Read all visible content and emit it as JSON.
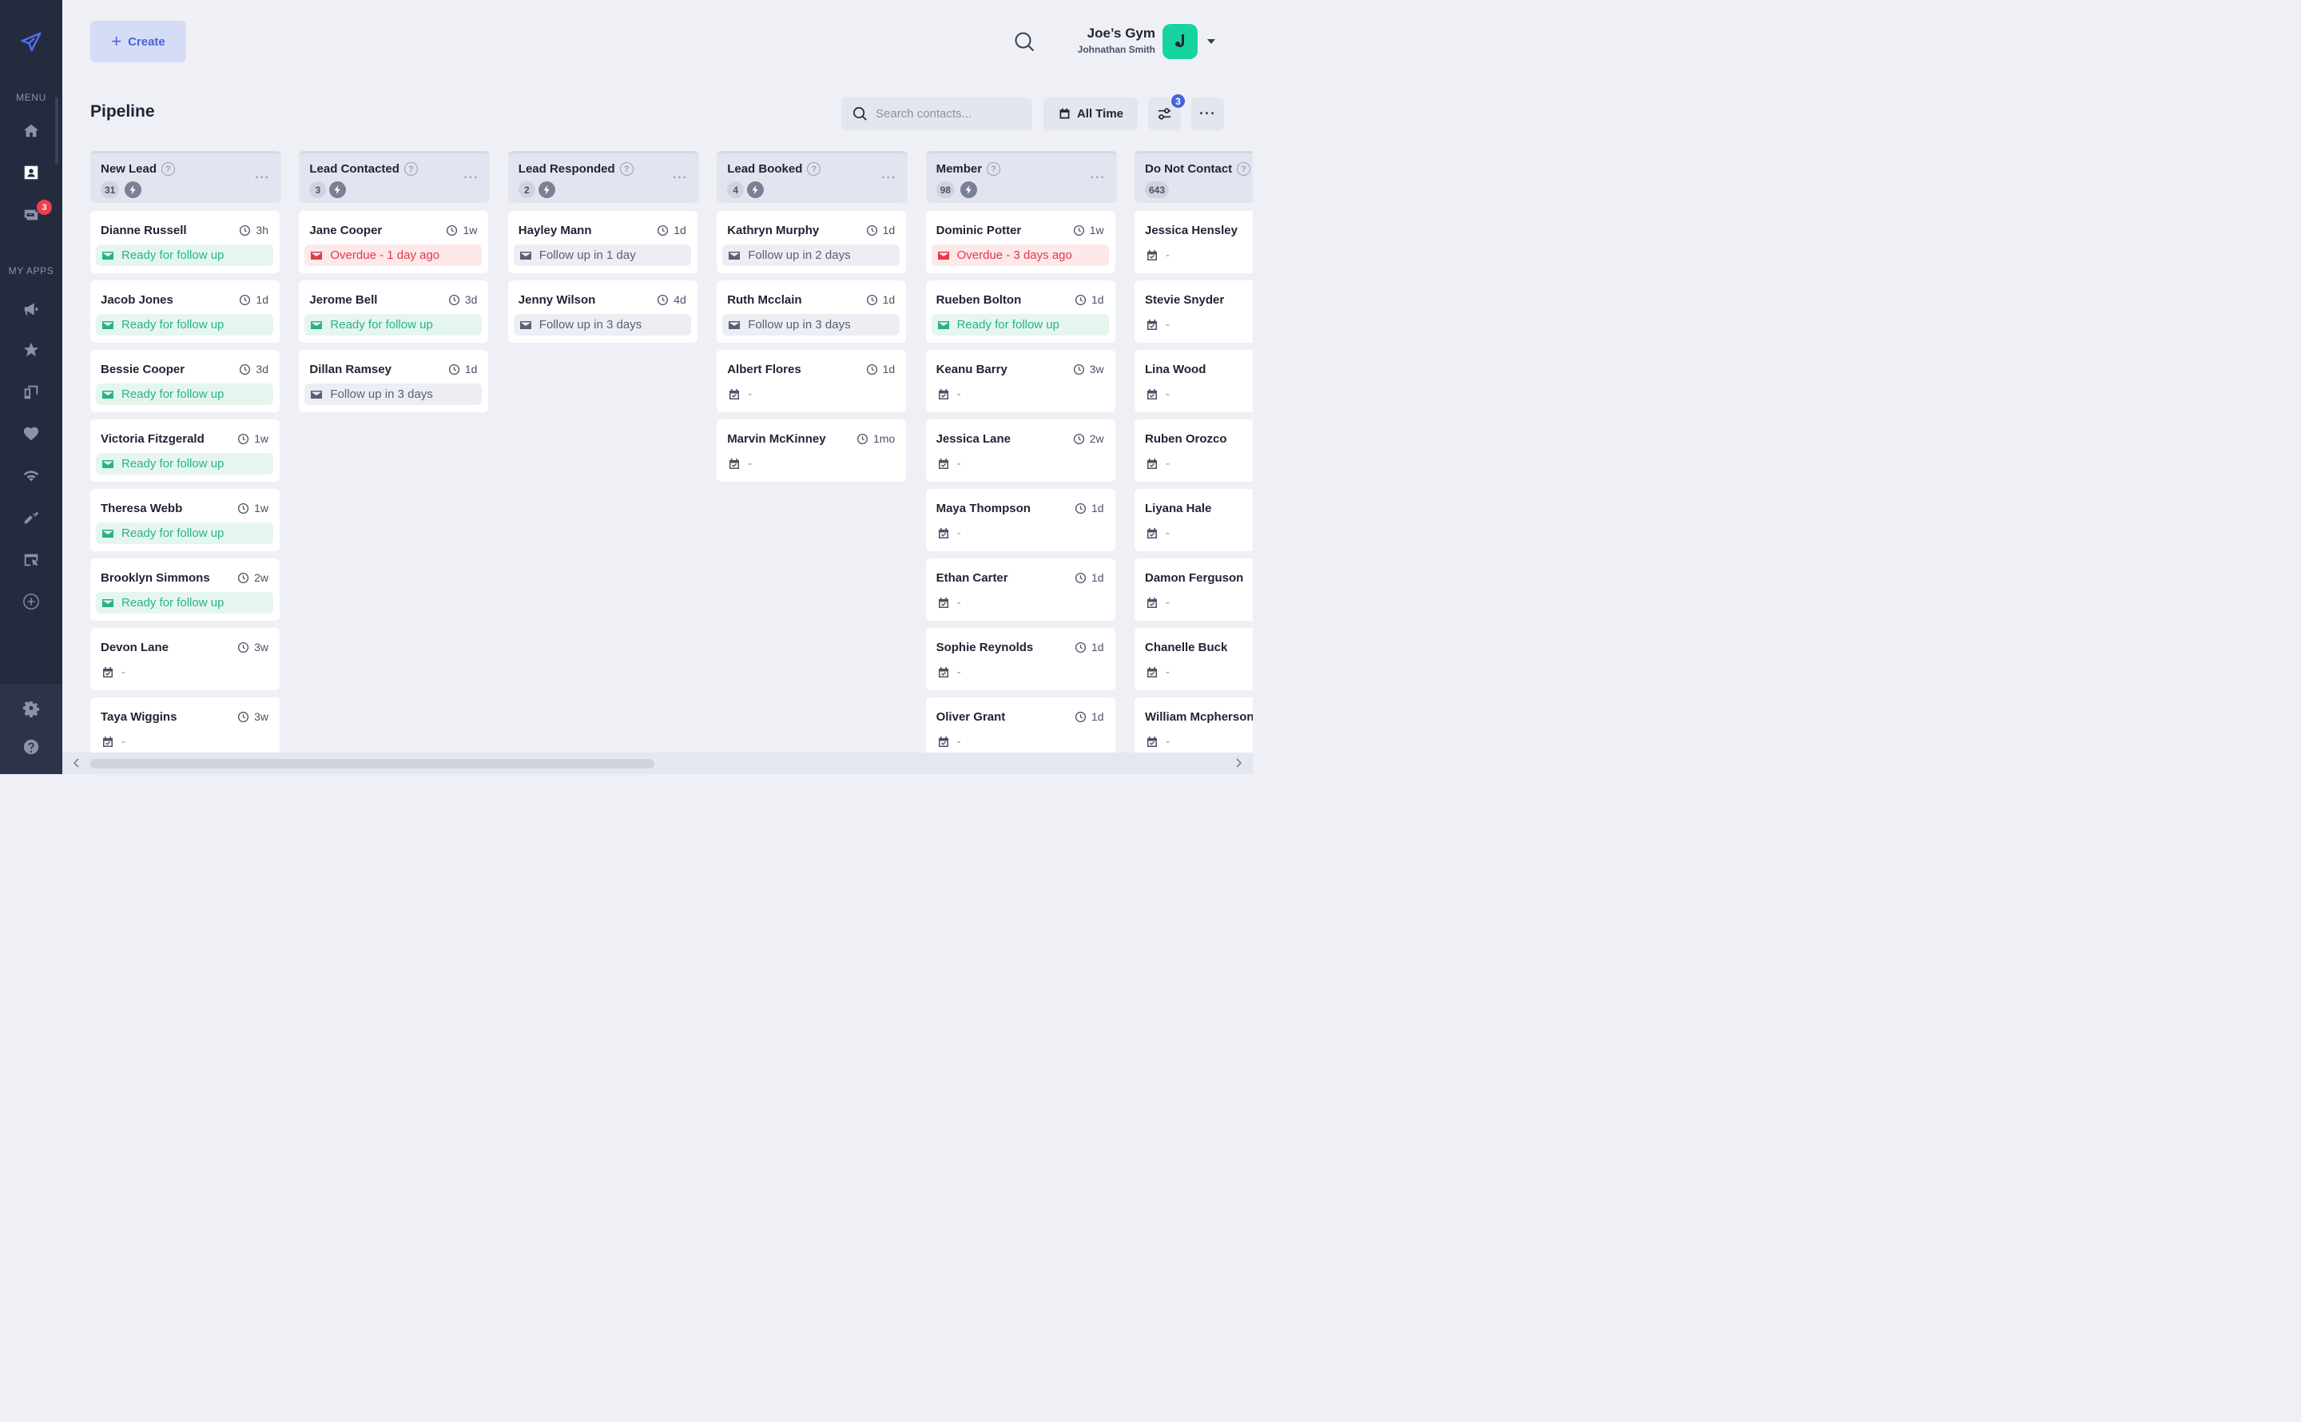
{
  "sidebar": {
    "menu_label": "MENU",
    "apps_label": "MY APPS",
    "inbox_badge": "3"
  },
  "header": {
    "create_label": "Create",
    "account_name": "Joe’s Gym",
    "account_user": "Johnathan Smith"
  },
  "toolbar": {
    "page_title": "Pipeline",
    "search_placeholder": "Search contacts...",
    "time_filter": "All Time",
    "filter_count": "3"
  },
  "colors": {
    "accent": "#4a63d9",
    "ready": "#2bb381",
    "overdue": "#e23a48",
    "avatar": "#17d3a0",
    "sidebar": "#252b3f"
  },
  "columns": [
    {
      "title": "New Lead",
      "count": "31",
      "automation": true,
      "cards": [
        {
          "name": "Dianne Russell",
          "age": "3h",
          "status": "Ready for follow up",
          "kind": "green"
        },
        {
          "name": "Jacob Jones",
          "age": "1d",
          "status": "Ready for follow up",
          "kind": "green"
        },
        {
          "name": "Bessie Cooper",
          "age": "3d",
          "status": "Ready for follow up",
          "kind": "green"
        },
        {
          "name": "Victoria Fitzgerald",
          "age": "1w",
          "status": "Ready for follow up",
          "kind": "green"
        },
        {
          "name": "Theresa Webb",
          "age": "1w",
          "status": "Ready for follow up",
          "kind": "green"
        },
        {
          "name": "Brooklyn Simmons",
          "age": "2w",
          "status": "Ready for follow up",
          "kind": "green"
        },
        {
          "name": "Devon Lane",
          "age": "3w",
          "status": "-",
          "kind": "plain"
        },
        {
          "name": "Taya Wiggins",
          "age": "3w",
          "status": "-",
          "kind": "plain"
        }
      ]
    },
    {
      "title": "Lead Contacted",
      "count": "3",
      "automation": true,
      "cards": [
        {
          "name": "Jane Cooper",
          "age": "1w",
          "status": "Overdue - 1 day ago",
          "kind": "red"
        },
        {
          "name": "Jerome Bell",
          "age": "3d",
          "status": "Ready for follow up",
          "kind": "green"
        },
        {
          "name": "Dillan Ramsey",
          "age": "1d",
          "status": "Follow up in 3 days",
          "kind": "gray"
        }
      ]
    },
    {
      "title": "Lead Responded",
      "count": "2",
      "automation": true,
      "cards": [
        {
          "name": "Hayley Mann",
          "age": "1d",
          "status": "Follow up in 1 day",
          "kind": "gray"
        },
        {
          "name": "Jenny Wilson",
          "age": "4d",
          "status": "Follow up in 3 days",
          "kind": "gray"
        }
      ]
    },
    {
      "title": "Lead Booked",
      "count": "4",
      "automation": true,
      "cards": [
        {
          "name": "Kathryn Murphy",
          "age": "1d",
          "status": "Follow up in 2 days",
          "kind": "gray"
        },
        {
          "name": "Ruth Mcclain",
          "age": "1d",
          "status": "Follow up in 3 days",
          "kind": "gray"
        },
        {
          "name": "Albert Flores",
          "age": "1d",
          "status": "-",
          "kind": "plain"
        },
        {
          "name": "Marvin McKinney",
          "age": "1mo",
          "status": "-",
          "kind": "plain"
        }
      ]
    },
    {
      "title": "Member",
      "count": "98",
      "automation": true,
      "cards": [
        {
          "name": "Dominic Potter",
          "age": "1w",
          "status": "Overdue - 3 days ago",
          "kind": "red"
        },
        {
          "name": "Rueben Bolton",
          "age": "1d",
          "status": "Ready for follow up",
          "kind": "green"
        },
        {
          "name": "Keanu Barry",
          "age": "3w",
          "status": "-",
          "kind": "plain"
        },
        {
          "name": "Jessica Lane",
          "age": "2w",
          "status": "-",
          "kind": "plain"
        },
        {
          "name": "Maya Thompson",
          "age": "1d",
          "status": "-",
          "kind": "plain"
        },
        {
          "name": "Ethan Carter",
          "age": "1d",
          "status": "-",
          "kind": "plain"
        },
        {
          "name": "Sophie Reynolds",
          "age": "1d",
          "status": "-",
          "kind": "plain"
        },
        {
          "name": "Oliver Grant",
          "age": "1d",
          "status": "-",
          "kind": "plain"
        }
      ]
    },
    {
      "title": "Do Not Contact",
      "count": "643",
      "automation": false,
      "cards": [
        {
          "name": "Jessica Hensley",
          "age": "",
          "status": "-",
          "kind": "plain"
        },
        {
          "name": "Stevie Snyder",
          "age": "",
          "status": "-",
          "kind": "plain"
        },
        {
          "name": "Lina Wood",
          "age": "",
          "status": "-",
          "kind": "plain"
        },
        {
          "name": "Ruben Orozco",
          "age": "",
          "status": "-",
          "kind": "plain"
        },
        {
          "name": "Liyana Hale",
          "age": "",
          "status": "-",
          "kind": "plain"
        },
        {
          "name": "Damon Ferguson",
          "age": "",
          "status": "-",
          "kind": "plain"
        },
        {
          "name": "Chanelle Buck",
          "age": "",
          "status": "-",
          "kind": "plain"
        },
        {
          "name": "William Mcpherson",
          "age": "",
          "status": "-",
          "kind": "plain"
        }
      ]
    }
  ]
}
